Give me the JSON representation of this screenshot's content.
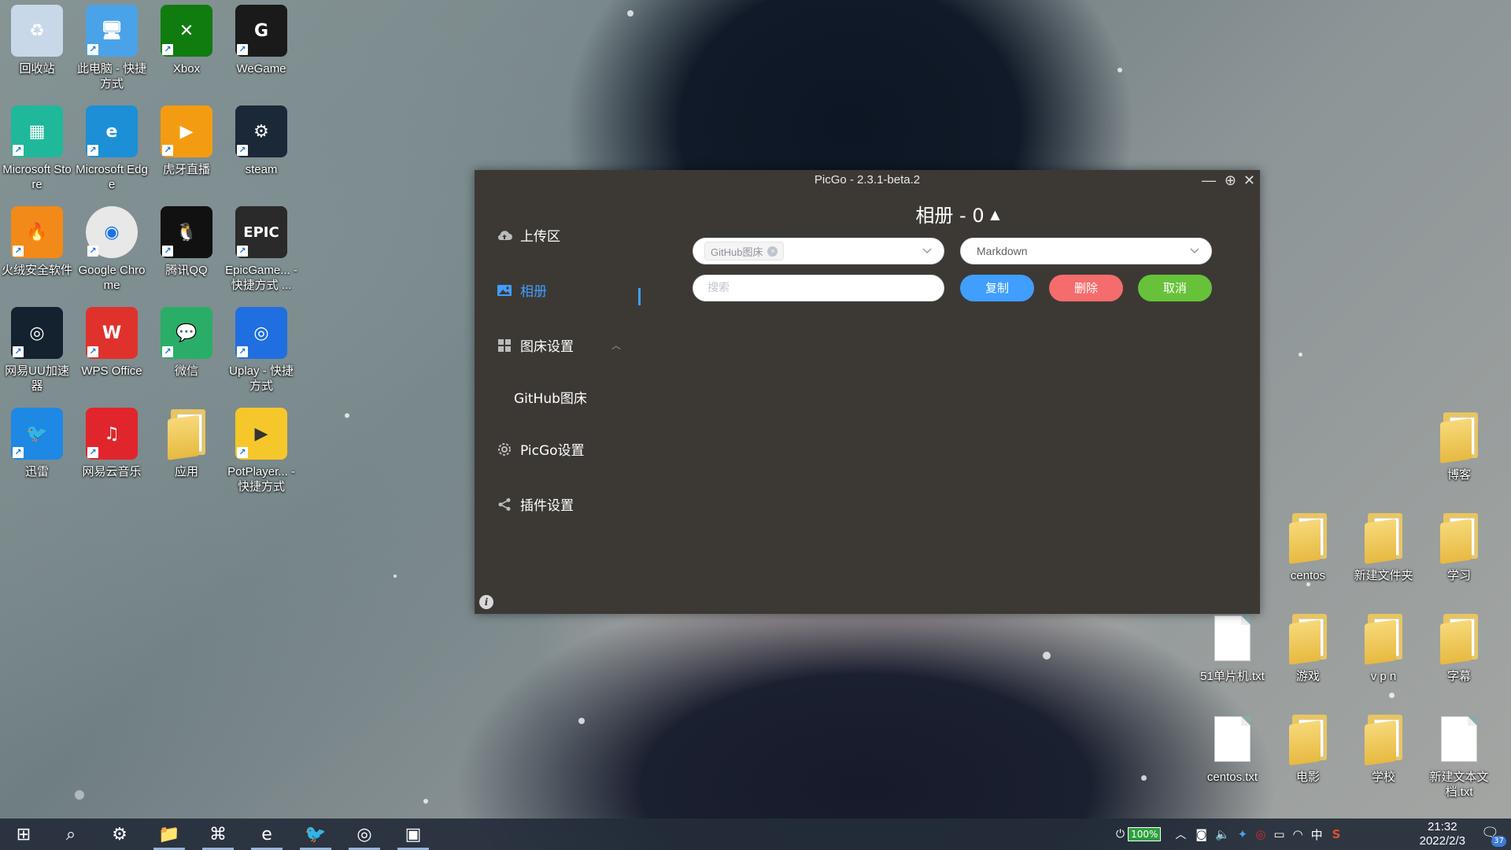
{
  "desktop": {
    "left_icons": [
      {
        "label": "回收站",
        "icon": "recycle-bin-icon",
        "color": "#c8d8e8"
      },
      {
        "label": "此电脑 - 快捷方式",
        "icon": "this-pc-icon",
        "color": "#4aa3e8"
      },
      {
        "label": "Xbox",
        "icon": "xbox-icon",
        "color": "#107c10"
      },
      {
        "label": "WeGame",
        "icon": "wegame-icon",
        "color": "#1a1a1a"
      },
      {
        "label": "Microsoft Store",
        "icon": "store-icon",
        "color": "#1fb89b"
      },
      {
        "label": "Microsoft Edge",
        "icon": "edge-icon",
        "color": "#1c8fd6"
      },
      {
        "label": "虎牙直播",
        "icon": "huya-icon",
        "color": "#f39c12"
      },
      {
        "label": "steam",
        "icon": "steam-icon",
        "color": "#1b2838"
      },
      {
        "label": "火绒安全软件",
        "icon": "huorong-icon",
        "color": "#f28a1a"
      },
      {
        "label": "Google Chrome",
        "icon": "chrome-icon",
        "color": "#e8e8e8"
      },
      {
        "label": "腾讯QQ",
        "icon": "qq-icon",
        "color": "#111111"
      },
      {
        "label": "EpicGame... - 快捷方式 ...",
        "icon": "epic-icon",
        "color": "#2a2a2a"
      },
      {
        "label": "网易UU加速器",
        "icon": "uu-icon",
        "color": "#13222e"
      },
      {
        "label": "WPS Office",
        "icon": "wps-icon",
        "color": "#e0322c"
      },
      {
        "label": "微信",
        "icon": "wechat-icon",
        "color": "#2aae67"
      },
      {
        "label": "Uplay - 快捷方式",
        "icon": "uplay-icon",
        "color": "#1f6fe0"
      },
      {
        "label": "迅雷",
        "icon": "xunlei-icon",
        "color": "#1e88e5"
      },
      {
        "label": "网易云音乐",
        "icon": "netease-music-icon",
        "color": "#e0262c"
      },
      {
        "label": "应用",
        "icon": "folder-icon",
        "color": "#e8c560"
      },
      {
        "label": "PotPlayer... - 快捷方式",
        "icon": "potplayer-icon",
        "color": "#f6c72a"
      }
    ],
    "right_icons": [
      {
        "label": "博客",
        "type": "folder"
      },
      {
        "label": "centos",
        "type": "folder"
      },
      {
        "label": "新建文件夹",
        "type": "folder"
      },
      {
        "label": "学习",
        "type": "folder"
      },
      {
        "label": "51单片机.txt",
        "type": "txt"
      },
      {
        "label": "游戏",
        "type": "folder"
      },
      {
        "label": "v p n",
        "type": "folder"
      },
      {
        "label": "字幕",
        "type": "folder"
      },
      {
        "label": "centos.txt",
        "type": "txt"
      },
      {
        "label": "电影",
        "type": "folder"
      },
      {
        "label": "学校",
        "type": "folder"
      },
      {
        "label": "新建文本文档.txt",
        "type": "txt"
      }
    ],
    "icon_glyphs": {
      "recycle": "♻",
      "pc": "🖥",
      "xbox": "✕",
      "wegame": "G",
      "store": "▦",
      "edge": "e",
      "huya": "▶",
      "steam": "⚙",
      "huorong": "🔥",
      "chrome": "◉",
      "qq": "🐧",
      "epic": "EPIC",
      "uu": "◎",
      "wps": "W",
      "wechat": "💬",
      "uplay": "◎",
      "xunlei": "🐦",
      "music": "♫",
      "app": "",
      "pot": "Player"
    }
  },
  "picgo": {
    "window_title": "PicGo - 2.3.1-beta.2",
    "window_controls": {
      "minimize": "—",
      "pin": "⊕",
      "close": "✕"
    },
    "nav": {
      "upload": "上传区",
      "gallery": "相册",
      "picbed_settings": "图床设置",
      "github_picbed": "GitHub图床",
      "picgo_settings": "PicGo设置",
      "plugin_settings": "插件设置"
    },
    "gallery_title": "相册 - 0",
    "gallery_title_arrow": "▲",
    "picbed_select": {
      "tag": "GitHub图床",
      "tag_close": "×"
    },
    "format_select": {
      "value": "Markdown"
    },
    "search": {
      "placeholder": "搜索"
    },
    "buttons": {
      "copy": "复制",
      "delete": "删除",
      "cancel": "取消",
      "copy_color": "#409eff",
      "delete_color": "#f56c6c",
      "cancel_color": "#67c23a"
    },
    "info_icon": "i"
  },
  "taskbar": {
    "apps": [
      {
        "name": "start",
        "glyph": "⊞",
        "running": false
      },
      {
        "name": "search",
        "glyph": "⌕",
        "running": false
      },
      {
        "name": "settings",
        "glyph": "⚙",
        "running": false
      },
      {
        "name": "file-explorer",
        "glyph": "📁",
        "running": true
      },
      {
        "name": "vscode",
        "glyph": "⌘",
        "running": true
      },
      {
        "name": "edge",
        "glyph": "e",
        "running": true
      },
      {
        "name": "xunlei",
        "glyph": "🐦",
        "running": true
      },
      {
        "name": "netease-music",
        "glyph": "◎",
        "running": true
      },
      {
        "name": "picgo",
        "glyph": "▣",
        "running": true
      }
    ],
    "battery": "100%",
    "ime": "中",
    "time": "21:32",
    "date": "2022/2/3",
    "notifications": "37"
  }
}
